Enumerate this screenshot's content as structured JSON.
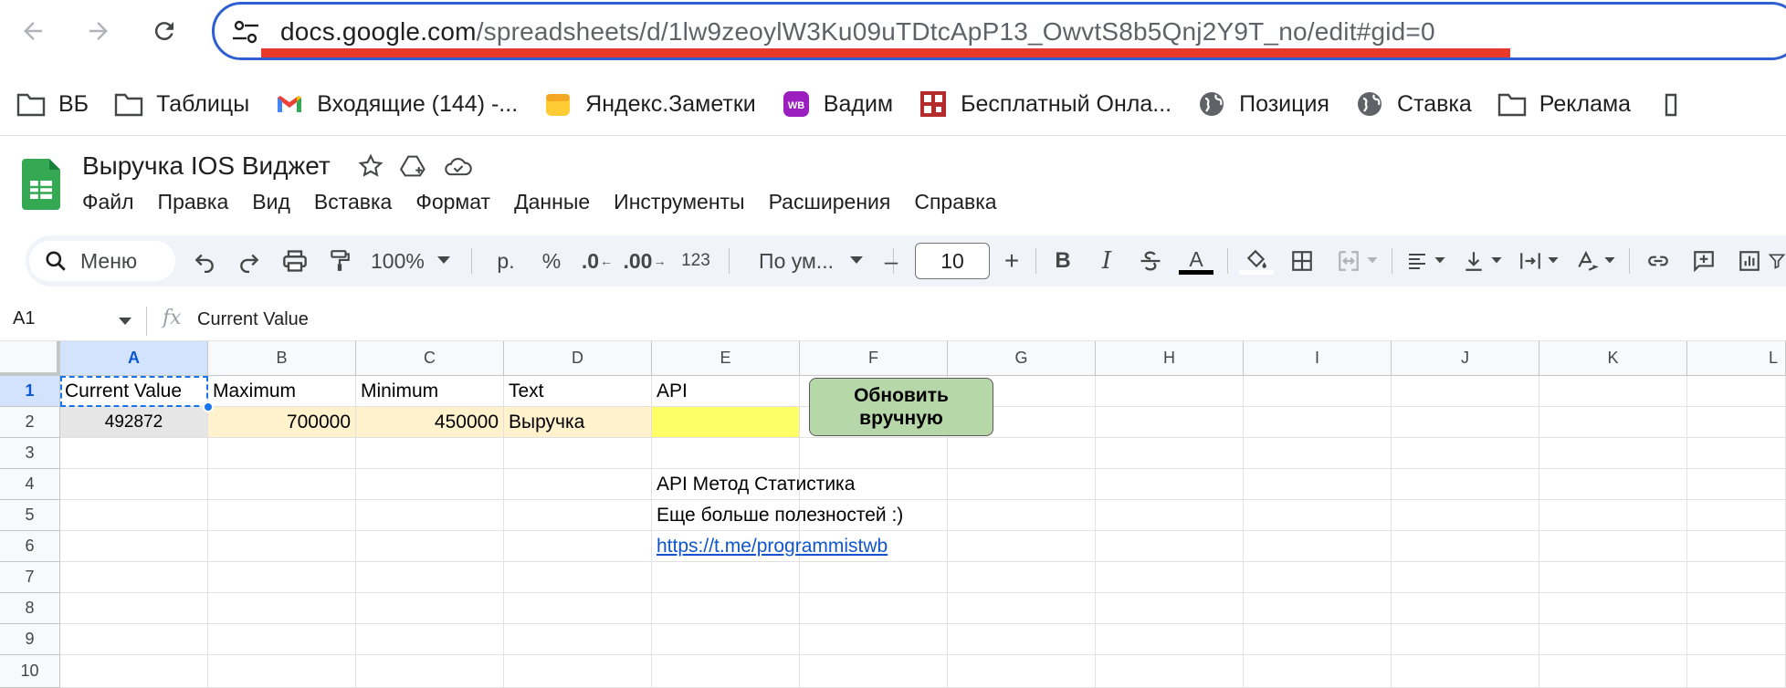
{
  "browser": {
    "url_host": "docs.google.com",
    "url_path": "/spreadsheets/d/1lw9zeoylW3Ku09uTDtcApP13_OwvtS8b5Qnj2Y9T_no/edit#gid=0"
  },
  "bookmarks": [
    {
      "label": "ВБ",
      "icon": "folder-icon"
    },
    {
      "label": "Таблицы",
      "icon": "folder-icon"
    },
    {
      "label": "Входящие (144) -...",
      "icon": "gmail-icon"
    },
    {
      "label": "Яндекс.Заметки",
      "icon": "notes-icon"
    },
    {
      "label": "Вадим",
      "icon": "wb-icon"
    },
    {
      "label": "Бесплатный Онла...",
      "icon": "qr-icon"
    },
    {
      "label": "Позиция",
      "icon": "globe-icon"
    },
    {
      "label": "Ставка",
      "icon": "globe-icon"
    },
    {
      "label": "Реклама",
      "icon": "folder-icon"
    }
  ],
  "doc": {
    "title": "Выручка IOS Виджет"
  },
  "menu": [
    "Файл",
    "Правка",
    "Вид",
    "Вставка",
    "Формат",
    "Данные",
    "Инструменты",
    "Расширения",
    "Справка"
  ],
  "toolbar": {
    "search_label": "Меню",
    "zoom": "100%",
    "currency": "р.",
    "percent": "%",
    "dec_decrease": ".0",
    "dec_increase": ".00",
    "number_format": "123",
    "font": "По ум...",
    "font_size": "10",
    "minus": "–",
    "plus": "+",
    "bold": "B",
    "italic": "I",
    "text_color_letter": "A",
    "text_color": "#000000"
  },
  "formula_bar": {
    "cell_ref": "A1",
    "fx": "fx",
    "value": "Current Value"
  },
  "grid": {
    "columns": [
      "A",
      "B",
      "C",
      "D",
      "E",
      "F",
      "G",
      "H",
      "I",
      "J",
      "K",
      "L"
    ],
    "rows": [
      "1",
      "2",
      "3",
      "4",
      "5",
      "6",
      "7",
      "8",
      "9",
      "10"
    ],
    "cells": {
      "A1": "Current Value",
      "B1": "Maximum",
      "C1": "Minimum",
      "D1": "Text",
      "E1": "API",
      "A2": "492872",
      "B2": "700000",
      "C2": "450000",
      "D2": "Выручка",
      "E4": "API Метод Статистика",
      "E5": "Еще больше полезностей :)",
      "E6": "https://t.me/programmistwb"
    },
    "button_label": "Обновить вручную",
    "colors": {
      "a2_fill": "#e6e6e6",
      "row2_fill": "#fff2cc",
      "api_fill": "#ffff66",
      "button_fill": "#b6d7a8"
    }
  }
}
